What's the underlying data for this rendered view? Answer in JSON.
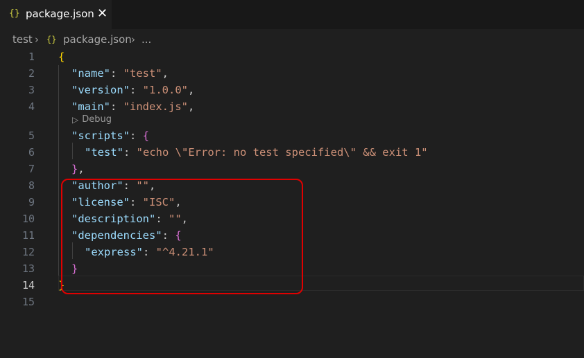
{
  "tab": {
    "icon": "{}",
    "title": "package.json",
    "close": "✕"
  },
  "breadcrumb": {
    "folder": "test",
    "file_icon": "{}",
    "file": "package.json",
    "more": "...",
    "sep": "›"
  },
  "codelens": {
    "label": "Debug"
  },
  "lines": [
    {
      "num": "1"
    },
    {
      "num": "2"
    },
    {
      "num": "3"
    },
    {
      "num": "4"
    },
    {
      "num": "5"
    },
    {
      "num": "6"
    },
    {
      "num": "7"
    },
    {
      "num": "8"
    },
    {
      "num": "9"
    },
    {
      "num": "10"
    },
    {
      "num": "11"
    },
    {
      "num": "12"
    },
    {
      "num": "13"
    },
    {
      "num": "14"
    },
    {
      "num": "15"
    }
  ],
  "json": {
    "name_key": "\"name\"",
    "name_val": "\"test\"",
    "version_key": "\"version\"",
    "version_val": "\"1.0.0\"",
    "main_key": "\"main\"",
    "main_val": "\"index.js\"",
    "scripts_key": "\"scripts\"",
    "test_key": "\"test\"",
    "test_val": "\"echo \\\"Error: no test specified\\\" && exit 1\"",
    "author_key": "\"author\"",
    "author_val": "\"\"",
    "license_key": "\"license\"",
    "license_val": "\"ISC\"",
    "description_key": "\"description\"",
    "description_val": "\"\"",
    "dependencies_key": "\"dependencies\"",
    "express_key": "\"express\"",
    "express_val": "\"^4.21.1\""
  },
  "colors": {
    "highlight_box": "#e00000",
    "key": "#9cdcfe",
    "string": "#ce9178"
  }
}
